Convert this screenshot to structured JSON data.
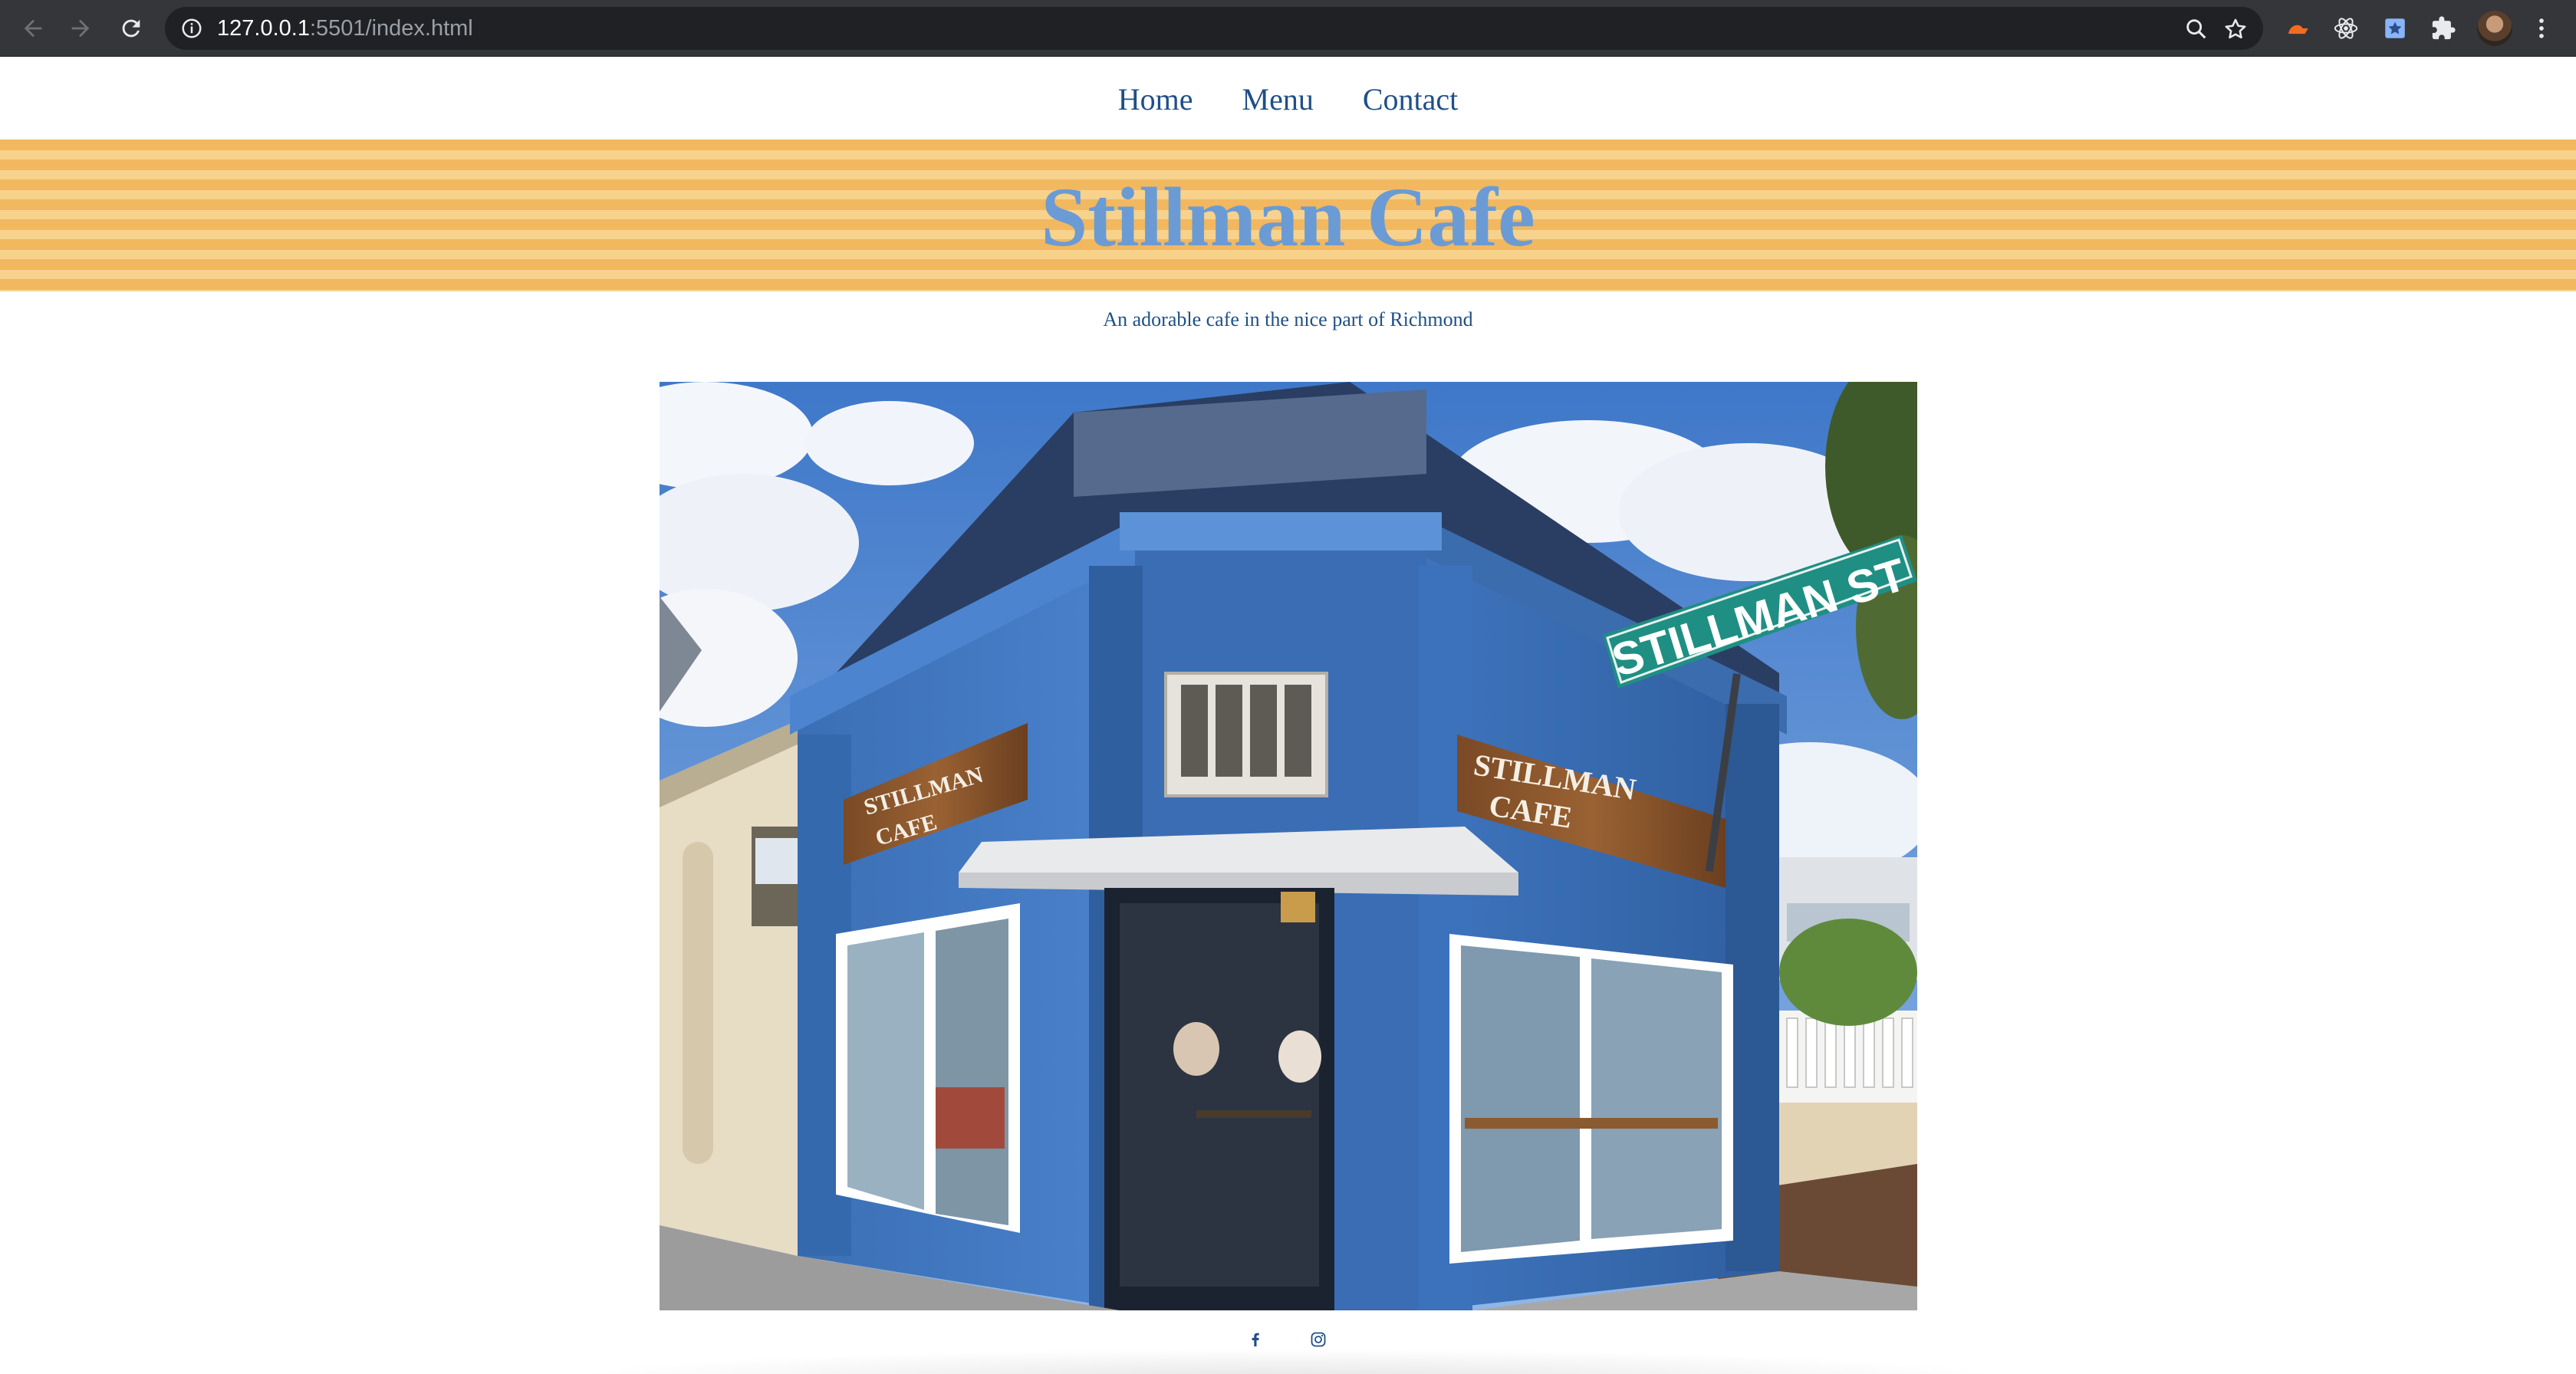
{
  "browser": {
    "url_host": "127.0.0.1",
    "url_rest": ":5501/index.html",
    "icons": [
      "back-icon",
      "forward-icon",
      "reload-icon",
      "info-icon",
      "zoom-icon",
      "bookmark-star-icon",
      "extension-icons",
      "puzzle-icon",
      "profile-avatar",
      "kebab-menu-icon"
    ]
  },
  "nav": {
    "items": [
      {
        "label": "Home"
      },
      {
        "label": "Menu"
      },
      {
        "label": "Contact"
      }
    ]
  },
  "hero": {
    "title": "Stillman Cafe",
    "tagline": "An adorable cafe in the nice part of Richmond"
  },
  "photo": {
    "street_sign": "STILLMAN ST",
    "sign_left_line1": "STILLMAN",
    "sign_left_line2": "CAFE",
    "sign_right_line1": "STILLMAN",
    "sign_right_line2": "CAFE"
  },
  "footer": {
    "social": [
      "facebook-icon",
      "instagram-icon"
    ]
  },
  "colors": {
    "nav_link": "#1f4f88",
    "title": "#6b9bd4",
    "stripe_dark": "#f1b860",
    "stripe_light": "#f6d28d",
    "browser_bar": "#35363a"
  }
}
